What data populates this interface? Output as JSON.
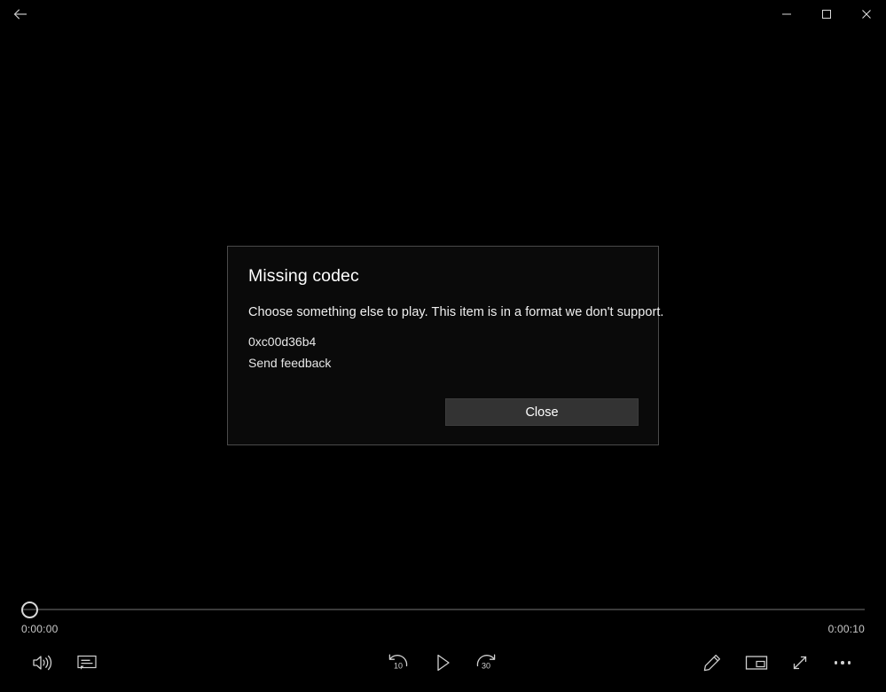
{
  "window": {
    "title": "",
    "back_label": "Back",
    "minimize_label": "Minimize",
    "maximize_label": "Maximize",
    "close_label": "Close"
  },
  "dialog": {
    "title": "Missing codec",
    "message": "Choose something else to play. This item is in a format we don't support.",
    "error_code": "0xc00d36b4",
    "feedback_link": "Send feedback",
    "close_button": "Close"
  },
  "player": {
    "current_time": "0:00:00",
    "total_time": "0:00:10",
    "progress_percent": 0,
    "is_playing": false,
    "controls": {
      "volume": "Volume",
      "captions": "Closed captioning",
      "rewind": "Rewind 10 seconds",
      "rewind_seconds": "10",
      "play": "Play",
      "forward": "Fast forward 30 seconds",
      "forward_seconds": "30",
      "edit": "Edit",
      "mini_player": "Mini view",
      "fullscreen": "Full screen",
      "more": "More options"
    }
  },
  "colors": {
    "background": "#000000",
    "dialog_bg": "#0a0a0a",
    "dialog_border": "#4a4a4a",
    "button_bg": "#333333",
    "text_primary": "#ffffff",
    "text_secondary": "#c9c9c9",
    "track": "#3a3a3a"
  }
}
